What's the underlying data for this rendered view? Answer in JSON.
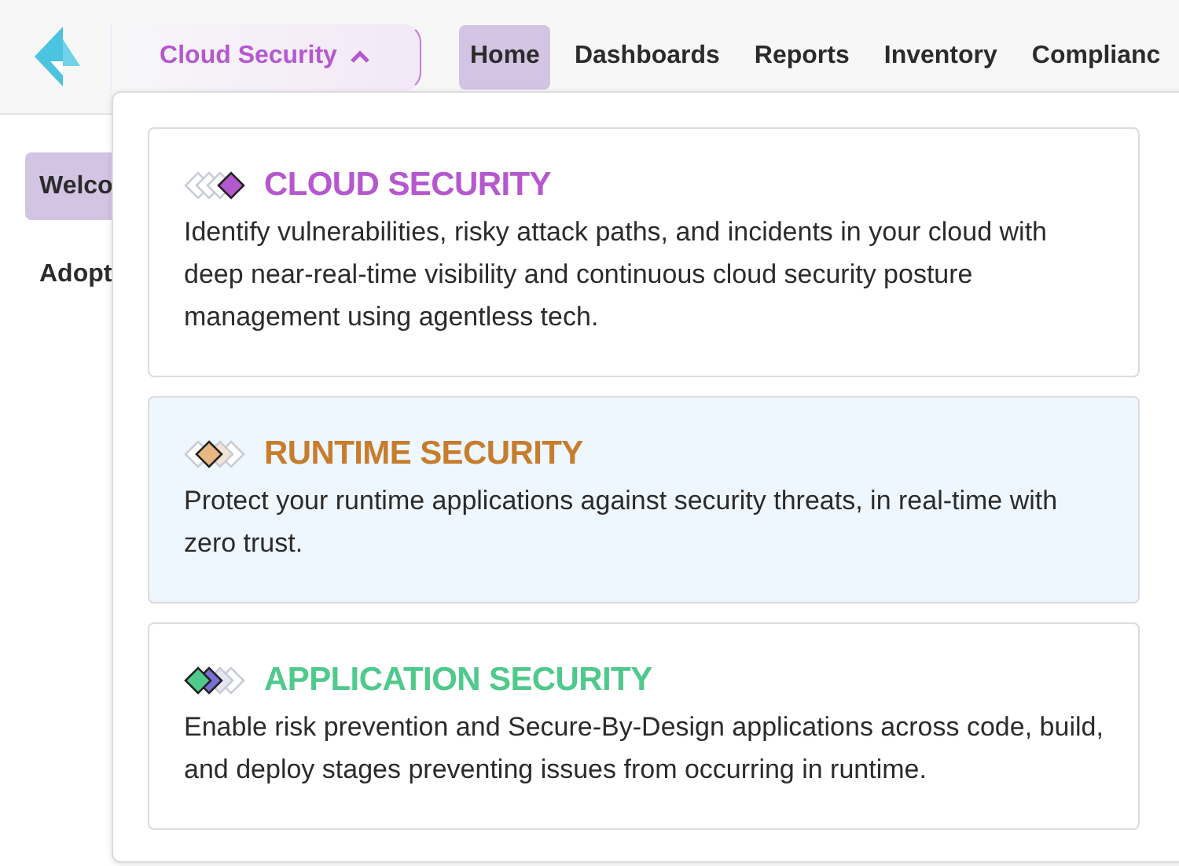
{
  "header": {
    "product_menu": {
      "label": "Cloud Security",
      "expanded": true
    },
    "nav": [
      {
        "label": "Home",
        "selected": true
      },
      {
        "label": "Dashboards",
        "selected": false
      },
      {
        "label": "Reports",
        "selected": false
      },
      {
        "label": "Inventory",
        "selected": false
      },
      {
        "label": "Complianc",
        "selected": false
      }
    ]
  },
  "sidebar": {
    "items": [
      {
        "label": "Welco",
        "selected": true
      },
      {
        "label": "Adopt",
        "selected": false
      }
    ]
  },
  "product_dropdown": {
    "cards": [
      {
        "kind": "cloud",
        "title": "CLOUD SECURITY",
        "color": "#b558cf",
        "selected": false,
        "description": "Identify vulnerabilities, risky attack paths, and incidents in your cloud with deep near-real-time visibility and continuous cloud security posture management using agentless tech."
      },
      {
        "kind": "runtime",
        "title": "RUNTIME SECURITY",
        "color": "#c67d2d",
        "selected": true,
        "description": "Protect your runtime applications against security threats, in real-time with zero trust."
      },
      {
        "kind": "application",
        "title": "APPLICATION SECURITY",
        "color": "#4fc98c",
        "selected": false,
        "description": "Enable risk prevention and Secure-By-Design applications across code, build, and deploy stages preventing issues from occurring in runtime."
      }
    ]
  }
}
